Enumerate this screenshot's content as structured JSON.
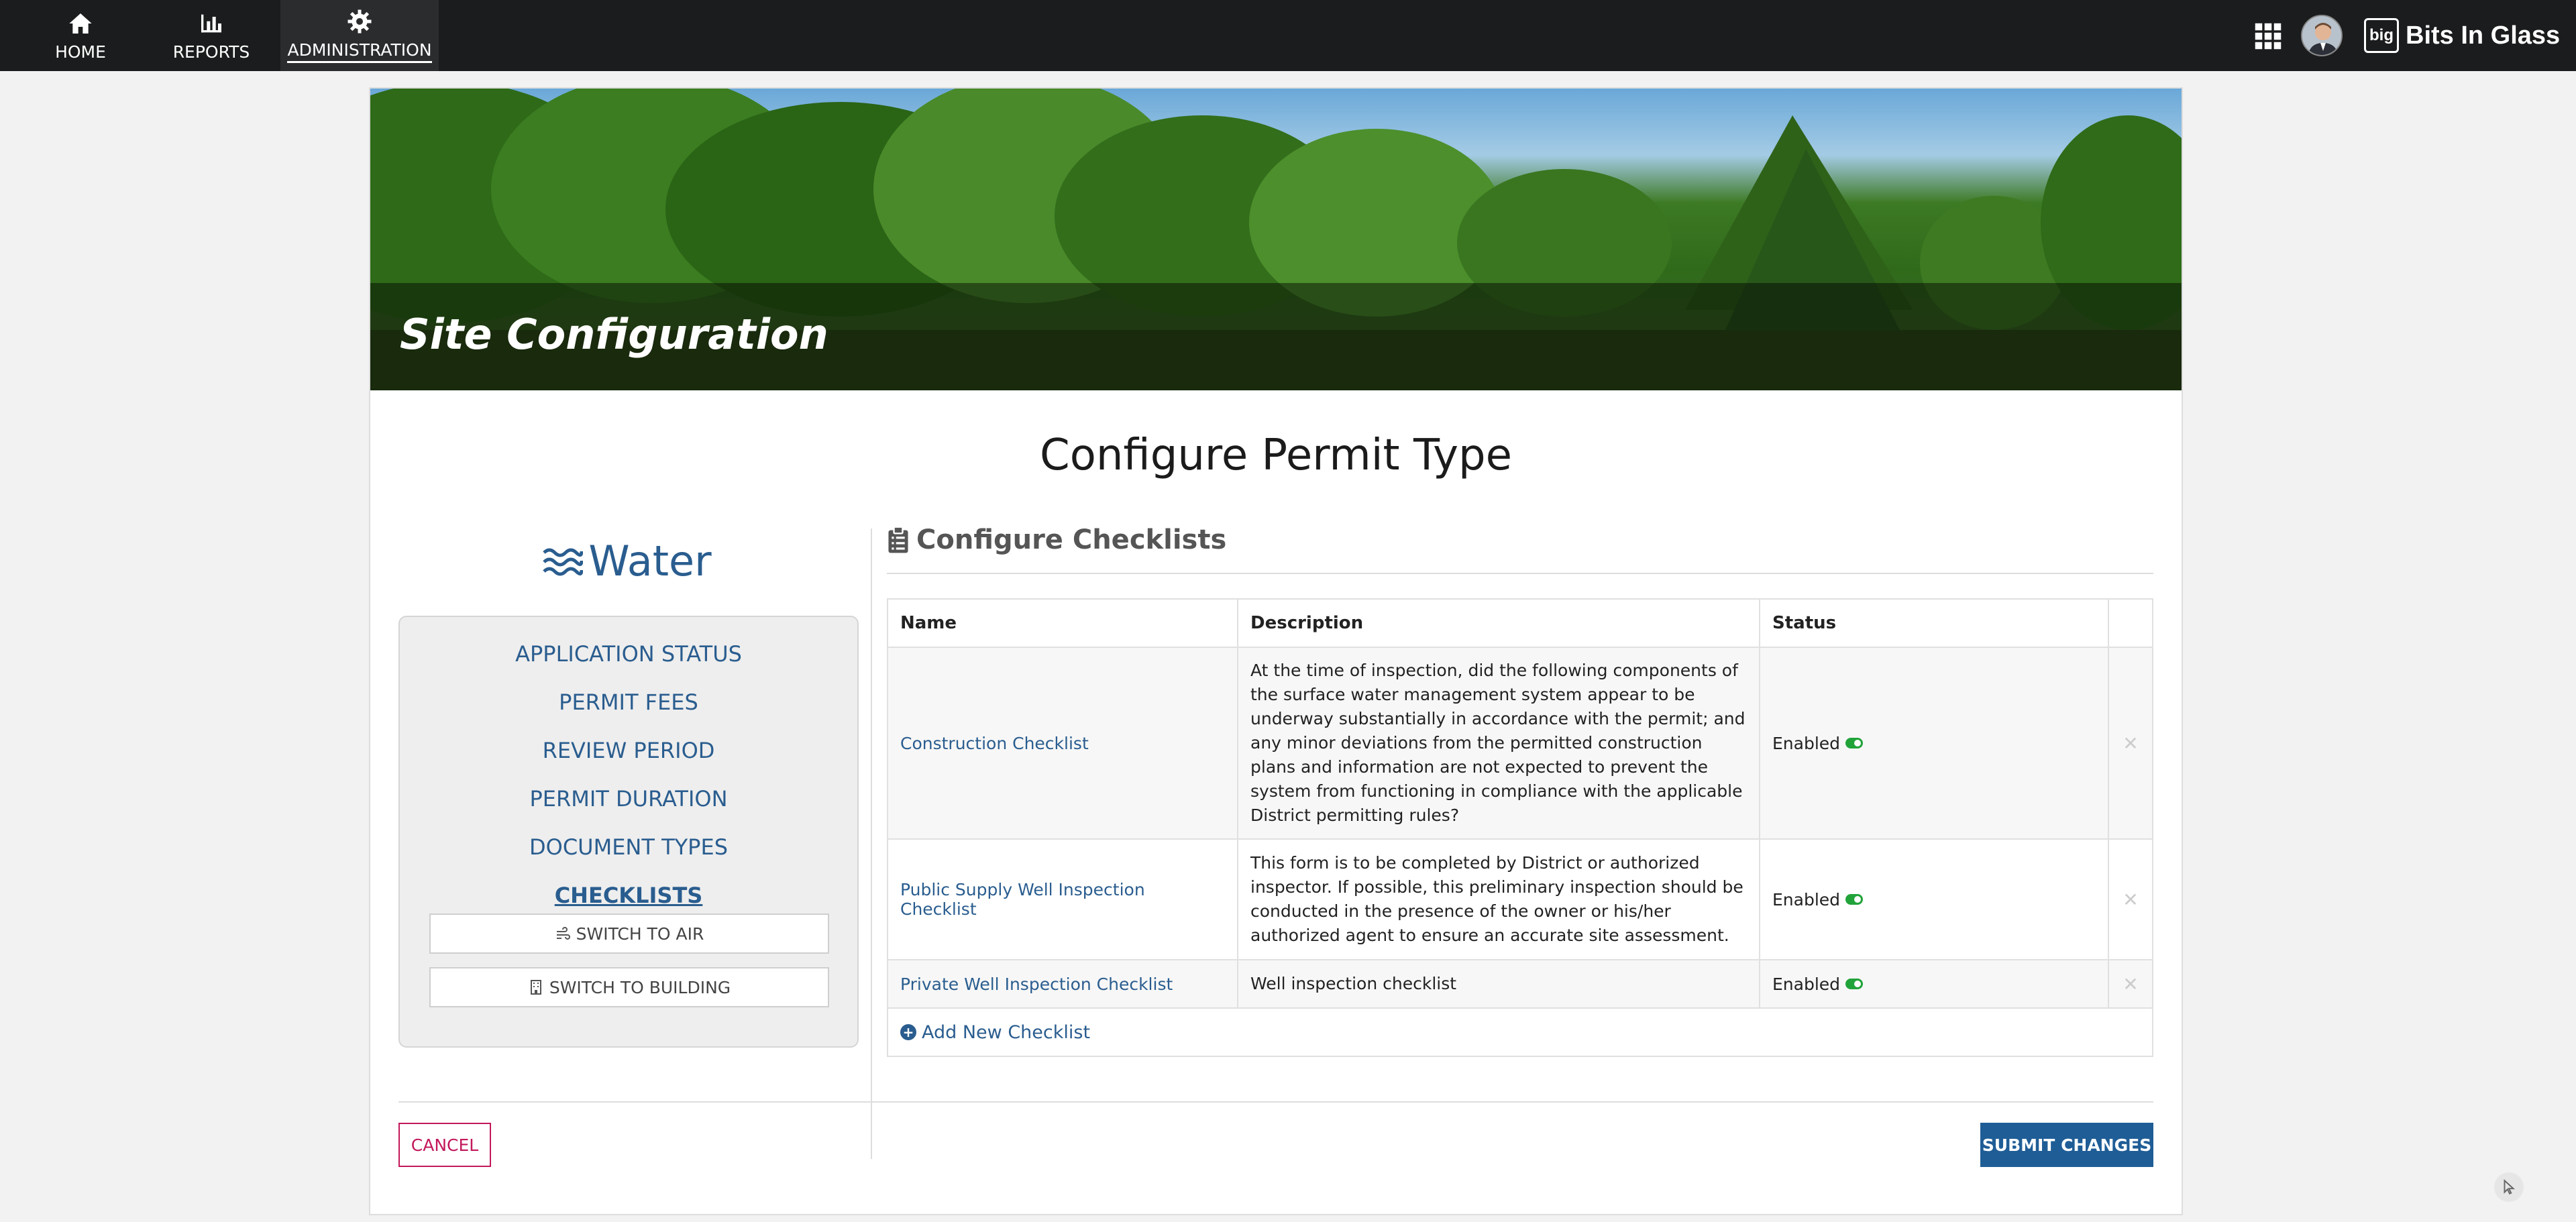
{
  "nav": {
    "items": [
      {
        "label": "HOME",
        "icon": "home-icon"
      },
      {
        "label": "REPORTS",
        "icon": "bar-chart-icon"
      },
      {
        "label": "ADMINISTRATION",
        "icon": "gear-icon"
      }
    ],
    "active": "ADMINISTRATION",
    "brand": "Bits In Glass",
    "brand_logo_text": "big"
  },
  "banner": {
    "title": "Site Configuration"
  },
  "page": {
    "heading": "Configure Permit Type"
  },
  "left": {
    "title": "Water",
    "links": [
      "APPLICATION STATUS",
      "PERMIT FEES",
      "REVIEW PERIOD",
      "PERMIT DURATION",
      "DOCUMENT TYPES",
      "CHECKLISTS"
    ],
    "active": "CHECKLISTS",
    "switch_air": "SWITCH TO AIR",
    "switch_building": "SWITCH TO BUILDING"
  },
  "checklists": {
    "section_title": "Configure Checklists",
    "columns": [
      "Name",
      "Description",
      "Status",
      ""
    ],
    "rows": [
      {
        "name": "Construction Checklist",
        "description": "At the time of inspection, did the following components of the surface water management system appear to be underway substantially in accordance with the permit; and any minor deviations from the permitted construction plans and information are not expected to prevent the system from functioning in compliance with the applicable District permitting rules?",
        "status": "Enabled"
      },
      {
        "name": "Public Supply Well Inspection Checklist",
        "description": "This form is to be completed by District or authorized inspector. If possible, this preliminary inspection should be conducted in the presence of the owner or his/her authorized agent to ensure an accurate site assessment.",
        "status": "Enabled"
      },
      {
        "name": "Private Well Inspection Checklist",
        "description": "Well inspection checklist",
        "status": "Enabled"
      }
    ],
    "add_label": "Add New Checklist"
  },
  "actions": {
    "cancel": "CANCEL",
    "submit": "SUBMIT CHANGES"
  },
  "colors": {
    "nav_bg": "#1b1c1d",
    "link": "#2a5d8f",
    "submit": "#1f5d96",
    "cancel": "#c2185b",
    "enabled": "#21a33a"
  }
}
